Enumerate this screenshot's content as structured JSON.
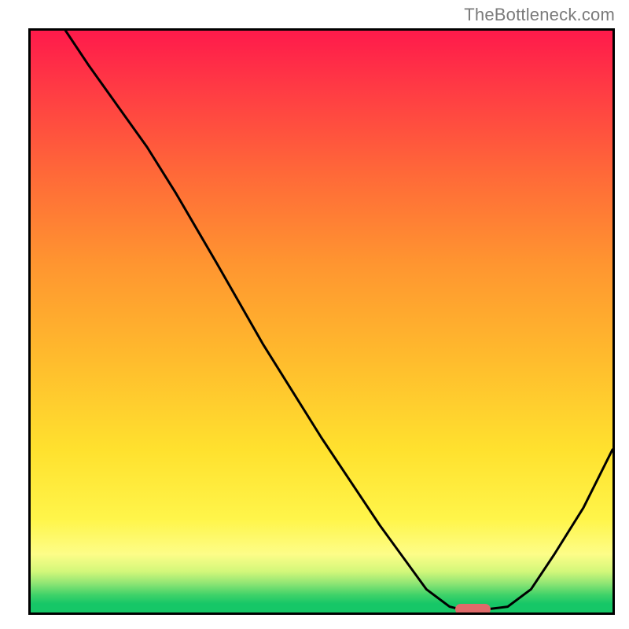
{
  "watermark": "TheBottleneck.com",
  "chart_data": {
    "type": "line",
    "title": "",
    "xlabel": "",
    "ylabel": "",
    "xlim": [
      0,
      100
    ],
    "ylim": [
      0,
      100
    ],
    "series": [
      {
        "name": "curve",
        "x": [
          6,
          10,
          15,
          20,
          25,
          32,
          40,
          50,
          60,
          68,
          72,
          74,
          78,
          82,
          86,
          90,
          95,
          100
        ],
        "values": [
          100,
          94,
          87,
          80,
          72,
          60,
          46,
          30,
          15,
          4,
          1,
          0.5,
          0.5,
          1,
          4,
          10,
          18,
          28
        ]
      }
    ],
    "marker": {
      "x_start": 73,
      "x_end": 79,
      "y": 0.5
    },
    "gradient_stops": [
      {
        "pos": 0,
        "color": "#ff1a4b"
      },
      {
        "pos": 25,
        "color": "#ff6a38"
      },
      {
        "pos": 55,
        "color": "#ffb82d"
      },
      {
        "pos": 84,
        "color": "#fff54a"
      },
      {
        "pos": 100,
        "color": "#16c767"
      }
    ]
  }
}
